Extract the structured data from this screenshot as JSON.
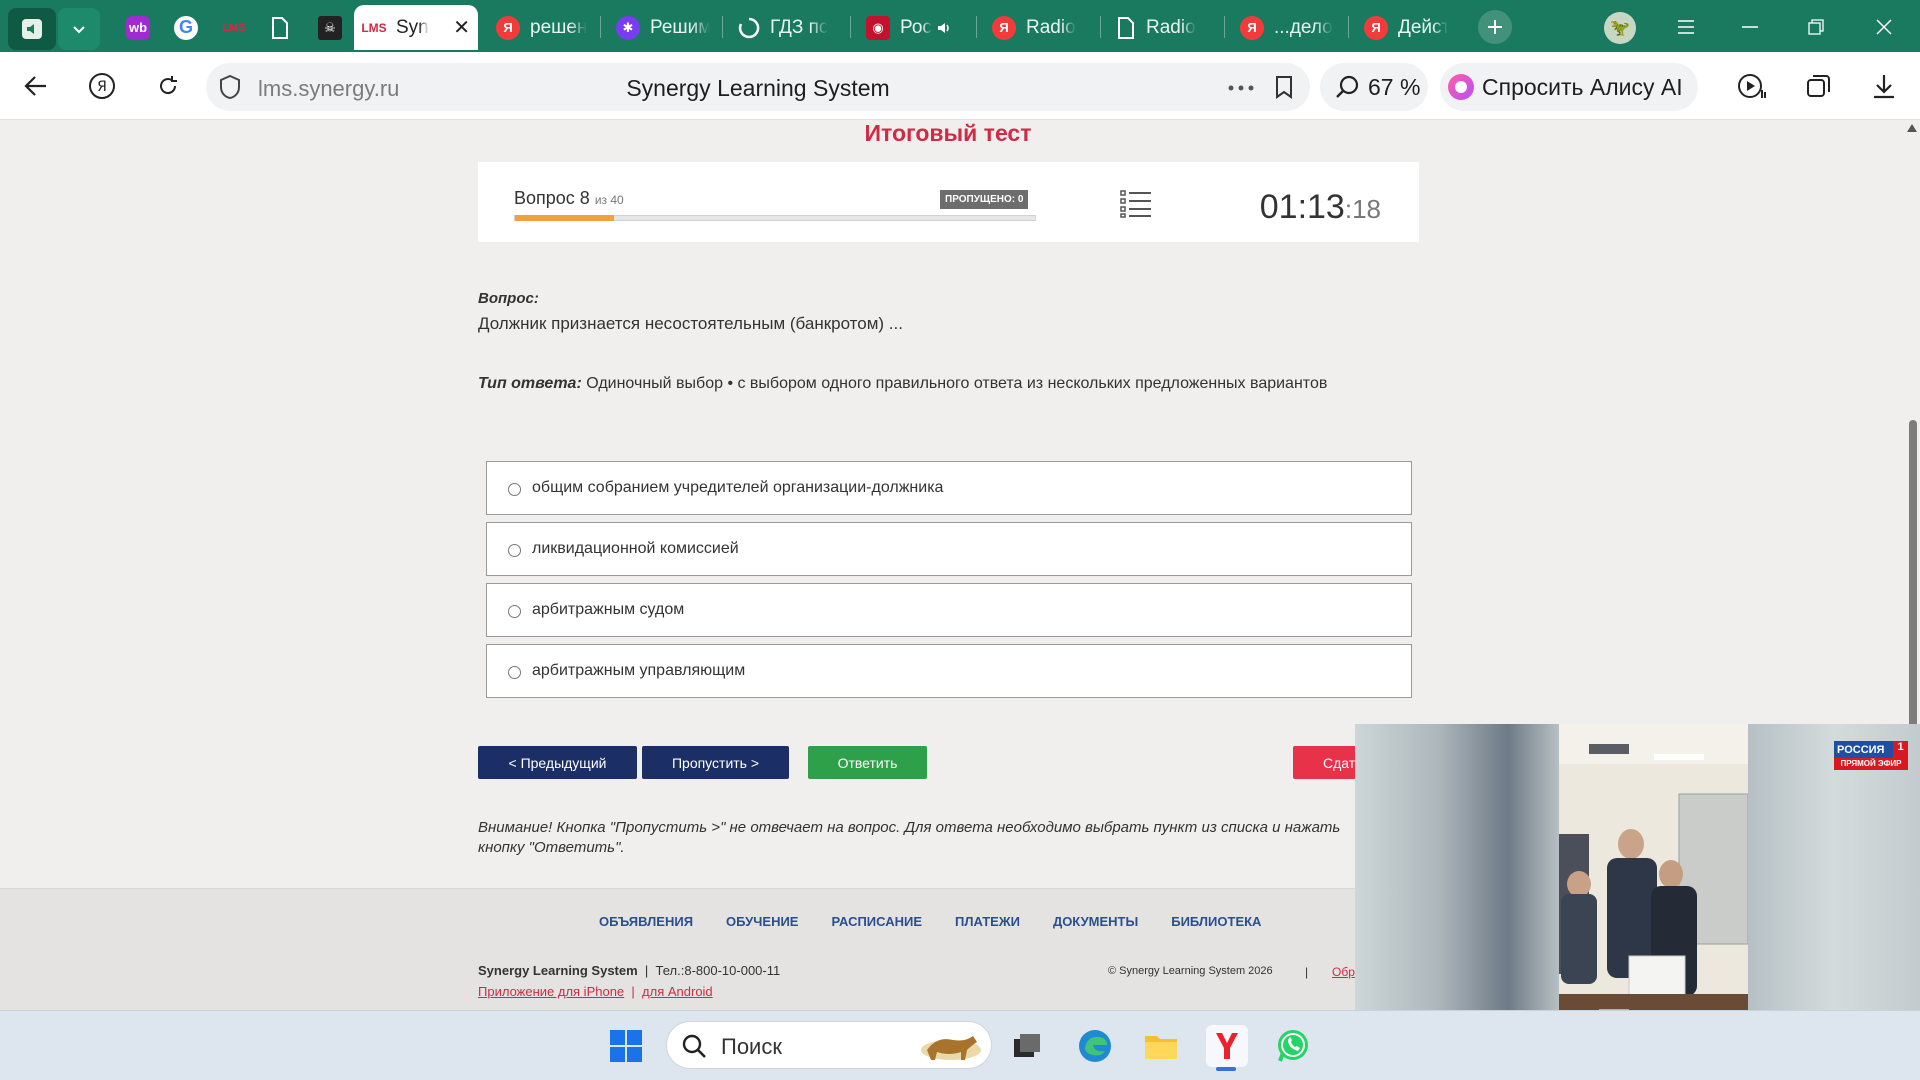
{
  "browser": {
    "tabs": [
      {
        "title": "",
        "favicon": "wb",
        "color": "#a12bd1"
      },
      {
        "title": "",
        "favicon": "G",
        "color": "#ffffff"
      },
      {
        "title": "",
        "favicon": "LMS",
        "color": "#d02a45"
      },
      {
        "title": "",
        "favicon": "doc",
        "color": "#ffffff"
      },
      {
        "title": "",
        "favicon": "pirate",
        "color": "#222222"
      },
      {
        "title": "Syn",
        "favicon": "LMS",
        "color": "#d02a45",
        "active": true
      },
      {
        "title": "решен",
        "favicon": "Я",
        "color": "#f33b3b"
      },
      {
        "title": "Решим",
        "favicon": "✱",
        "color": "#7a3cf0"
      },
      {
        "title": "ГДЗ пс",
        "favicon": "loading",
        "color": "#ffffff"
      },
      {
        "title": "Рос",
        "favicon": "lips",
        "color": "#c4122e",
        "audio": true
      },
      {
        "title": "Radio",
        "favicon": "Я",
        "color": "#f33b3b"
      },
      {
        "title": "Radio",
        "favicon": "doc",
        "color": "#ffffff"
      },
      {
        "title": "...дело",
        "favicon": "Я",
        "color": "#f33b3b"
      },
      {
        "title": "Дейст",
        "favicon": "Я",
        "color": "#f33b3b"
      }
    ],
    "url_domain": "lms.synergy.ru",
    "page_title": "Synergy Learning System",
    "zoom": "67 %",
    "alice_label": "Спросить Алису AI"
  },
  "test": {
    "title": "Итоговый тест",
    "question_label": "Вопрос 8",
    "question_of": "из 40",
    "progress_fraction": 0.19,
    "skipped_badge": "ПРОПУЩЕНО: 0",
    "timer_main": "01:13",
    "timer_sec": ":18",
    "q_heading": "Вопрос:",
    "q_text": "Должник признается несостоятельным (банкротом) ...",
    "type_heading": "Тип ответа:",
    "type_text": " Одиночный выбор • с выбором одного правильного ответа из нескольких предложенных вариантов",
    "options": [
      "общим собранием учредителей организации-должника",
      "ликвидационной комиссией",
      "арбитражным судом",
      "арбитражным управляющим"
    ],
    "btn_prev": "< Предыдущий",
    "btn_skip": "Пропустить >",
    "btn_answer": "Ответить",
    "btn_submit": "Сдать",
    "notice": "Внимание! Кнопка \"Пропустить >\" не отвечает на вопрос. Для ответа необходимо выбрать пункт из списка и нажать кнопку \"Ответить\"."
  },
  "footer": {
    "nav": [
      "ОБЪЯВЛЕНИЯ",
      "ОБУЧЕНИЕ",
      "РАСПИСАНИЕ",
      "ПЛАТЕЖИ",
      "ДОКУМЕНТЫ",
      "БИБЛИОТЕКА"
    ],
    "brand": "Synergy Learning System",
    "phone": "Тел.:8-800-10-000-11",
    "link_iphone": "Приложение для iPhone",
    "link_android": "для Android",
    "copyright": "© Synergy Learning System 2026",
    "link_right": "Обр"
  },
  "video": {
    "channel": "РОССИЯ",
    "channel_number": "1",
    "live_label": "ПРЯМОЙ ЭФИР"
  },
  "taskbar": {
    "search_placeholder": "Поиск"
  }
}
